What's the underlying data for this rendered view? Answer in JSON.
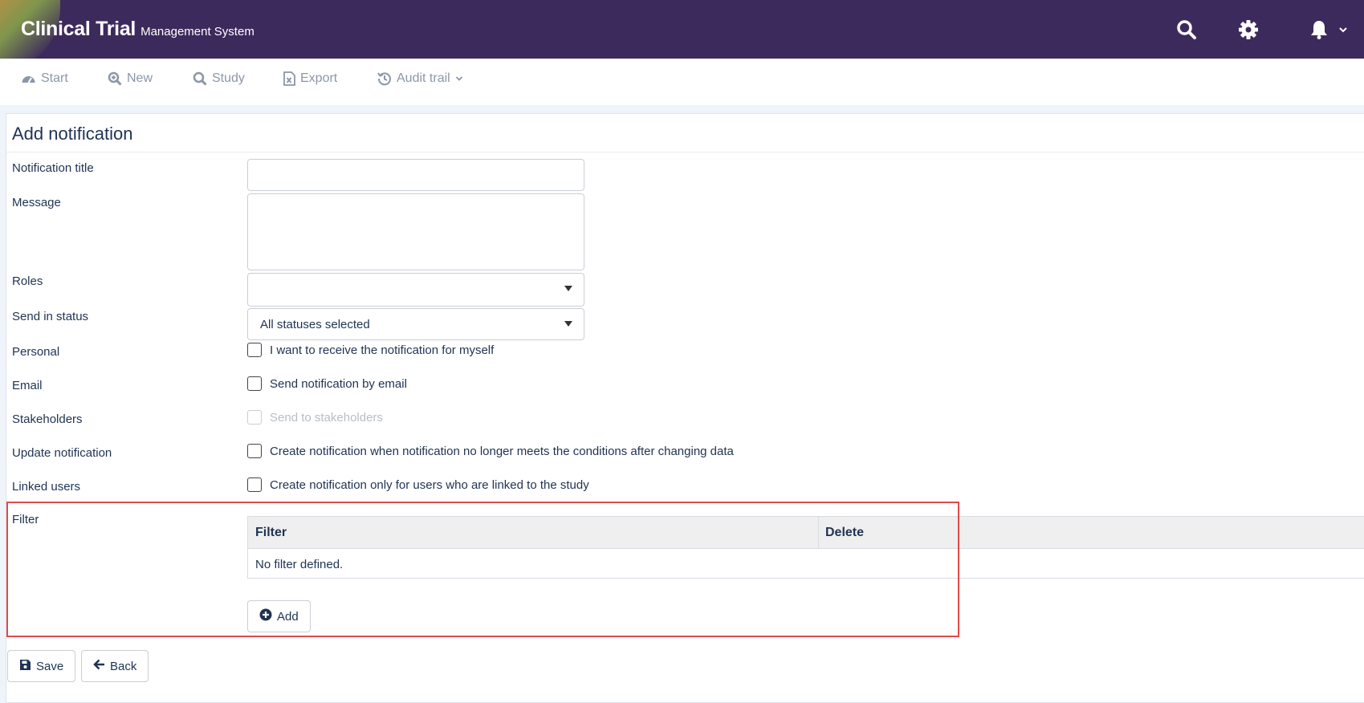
{
  "header": {
    "brand_main": "Clinical Trial",
    "brand_sub": "Management System",
    "icons": [
      "search-icon",
      "gear-icon",
      "bell-icon",
      "chevron-down-icon"
    ]
  },
  "nav": {
    "items": [
      {
        "label": "Start",
        "icon": "dashboard-icon"
      },
      {
        "label": "New",
        "icon": "zoom-plus-icon"
      },
      {
        "label": "Study",
        "icon": "search-icon"
      },
      {
        "label": "Export",
        "icon": "excel-file-icon"
      },
      {
        "label": "Audit trail",
        "icon": "history-icon"
      }
    ]
  },
  "form": {
    "title": "Add notification",
    "labels": {
      "notification_title": "Notification title",
      "message": "Message",
      "roles": "Roles",
      "send_in_status": "Send in status",
      "personal": "Personal",
      "email": "Email",
      "stakeholders": "Stakeholders",
      "update_notification": "Update notification",
      "linked_users": "Linked users",
      "filter": "Filter"
    },
    "values": {
      "notification_title": "",
      "message": "",
      "roles": "",
      "send_in_status": "All statuses selected"
    },
    "checkboxes": {
      "personal": "I want to receive the notification for myself",
      "email": "Send notification by email",
      "stakeholders": "Send to stakeholders",
      "update_notification": "Create notification when notification no longer meets the conditions after changing data",
      "linked_users": "Create notification only for users who are linked to the study"
    },
    "filter_table": {
      "columns": [
        "Filter",
        "Delete"
      ],
      "empty_text": "No filter defined."
    },
    "add_label": "Add"
  },
  "footer": {
    "save_label": "Save",
    "back_label": "Back"
  },
  "colors": {
    "header_bg": "#3d2a5c",
    "text": "#1f3353",
    "highlight": "#e24a4a"
  }
}
